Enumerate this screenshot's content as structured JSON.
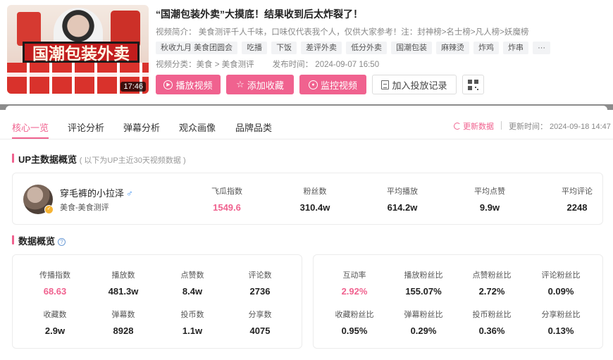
{
  "video": {
    "thumbnail_text": "国潮包装外卖",
    "duration": "17:46",
    "title": "“国潮包装外卖”大摸底！结果收到后太炸裂了！",
    "intro": "视频简介： 美食测评千人千味，口味仅代表我个人，仅供大家参考！注：封神榜>名士榜>凡人榜>妖魔榜",
    "tags": [
      "秋收九月 美食团圆会",
      "吃播",
      "下饭",
      "差评外卖",
      "低分外卖",
      "国潮包装",
      "麻辣烫",
      "炸鸡",
      "炸串",
      "···"
    ],
    "category": "视频分类：美食 > 美食测评",
    "publish_time": "发布时间： 2024-09-07 16:50",
    "actions": {
      "play": "播放视频",
      "favorite": "添加收藏",
      "monitor": "监控视频",
      "add_record": "加入投放记录"
    }
  },
  "tabs": [
    "核心一览",
    "评论分析",
    "弹幕分析",
    "观众画像",
    "品牌品类"
  ],
  "active_tab": 0,
  "refresh_label": "更新数据",
  "update_time": "更新时间： 2024-09-18 14:47",
  "up_section": {
    "title": "UP主数据概览",
    "subtitle": "( 以下为UP主近30天视频数据 )"
  },
  "up": {
    "name": "穿毛裤的小拉泽",
    "gender_symbol": "♂",
    "category": "美食-美食测评",
    "stats": [
      {
        "label": "飞瓜指数",
        "value": "1549.6",
        "highlight": true
      },
      {
        "label": "粉丝数",
        "value": "310.4w"
      },
      {
        "label": "平均播放",
        "value": "614.2w"
      },
      {
        "label": "平均点赞",
        "value": "9.9w"
      },
      {
        "label": "平均评论",
        "value": "2248"
      }
    ]
  },
  "data_section": {
    "title": "数据概览",
    "help_icon": "?"
  },
  "data_left": [
    {
      "label": "传播指数",
      "value": "68.63",
      "highlight": true
    },
    {
      "label": "播放数",
      "value": "481.3w"
    },
    {
      "label": "点赞数",
      "value": "8.4w"
    },
    {
      "label": "评论数",
      "value": "2736"
    },
    {
      "label": "收藏数",
      "value": "2.9w"
    },
    {
      "label": "弹幕数",
      "value": "8928"
    },
    {
      "label": "投币数",
      "value": "1.1w"
    },
    {
      "label": "分享数",
      "value": "4075"
    }
  ],
  "data_right": [
    {
      "label": "互动率",
      "value": "2.92%",
      "highlight": true
    },
    {
      "label": "播放粉丝比",
      "value": "155.07%"
    },
    {
      "label": "点赞粉丝比",
      "value": "2.72%"
    },
    {
      "label": "评论粉丝比",
      "value": "0.09%"
    },
    {
      "label": "收藏粉丝比",
      "value": "0.95%"
    },
    {
      "label": "弹幕粉丝比",
      "value": "0.29%"
    },
    {
      "label": "投币粉丝比",
      "value": "0.36%"
    },
    {
      "label": "分享粉丝比",
      "value": "0.13%"
    }
  ],
  "colors": {
    "accent": "#f0628f",
    "link_blue": "#3b8ff0"
  }
}
